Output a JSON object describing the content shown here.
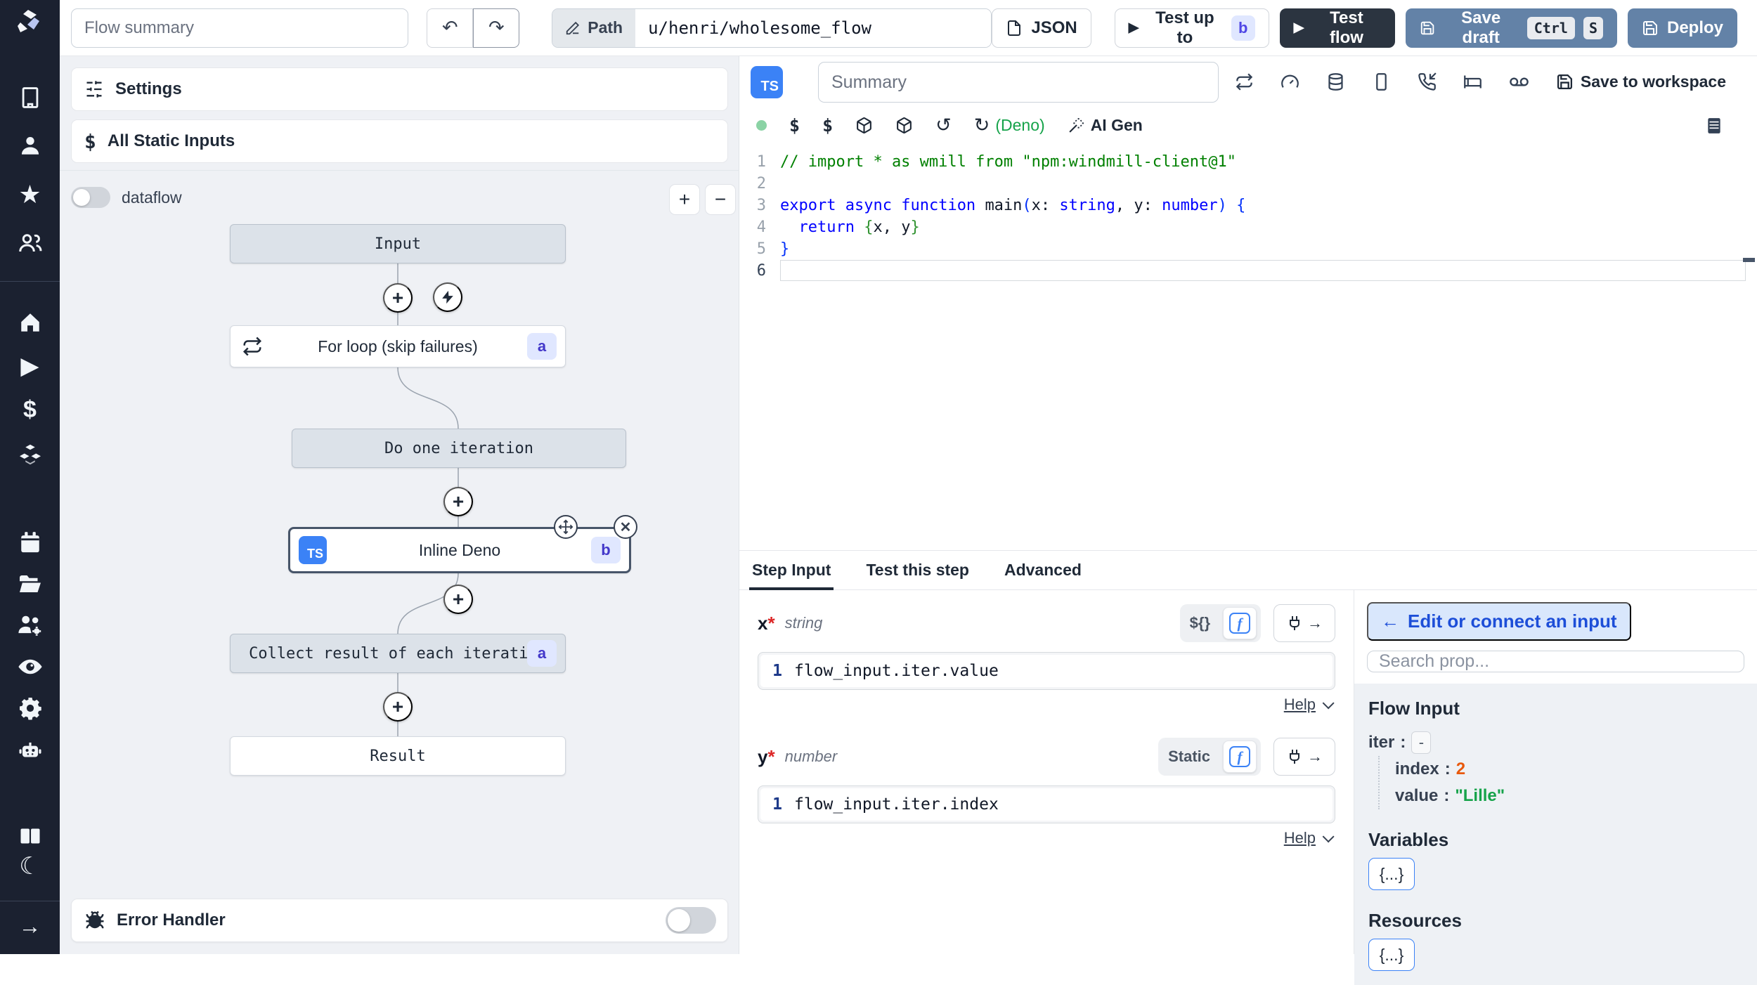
{
  "topbar": {
    "summary_placeholder": "Flow summary",
    "path_label": "Path",
    "path_value": "u/henri/wholesome_flow",
    "json_label": "JSON",
    "test_up_to_label": "Test up to",
    "test_up_to_badge": "b",
    "test_flow_label": "Test flow",
    "save_draft_label": "Save draft",
    "kbd_ctrl": "Ctrl",
    "kbd_s": "S",
    "deploy_label": "Deploy"
  },
  "flow_panel": {
    "settings_label": "Settings",
    "static_inputs_label": "All Static Inputs",
    "dataflow_label": "dataflow",
    "zoom_in": "+",
    "zoom_out": "−",
    "error_handler_label": "Error Handler",
    "nodes": {
      "input": {
        "label": "Input"
      },
      "forloop": {
        "label": "For loop (skip failures)",
        "badge": "a"
      },
      "iteration": {
        "label": "Do one iteration"
      },
      "inline": {
        "label": "Inline Deno",
        "badge": "b",
        "lang": "TS"
      },
      "collect": {
        "label": "Collect result of each iteration",
        "badge": "a"
      },
      "result": {
        "label": "Result"
      }
    }
  },
  "editor": {
    "lang_badge": "TS",
    "summary_placeholder": "Summary",
    "dollar1": "$",
    "dollar2": "$",
    "deno_label": "(Deno)",
    "ai_gen_label": "AI Gen",
    "save_workspace_label": "Save to workspace",
    "code_lines": [
      {
        "num": "1",
        "active": false,
        "tokens": [
          {
            "c": "com",
            "t": "// import * as wmill from \"npm:windmill-client@1\""
          }
        ]
      },
      {
        "num": "2",
        "active": false,
        "tokens": []
      },
      {
        "num": "3",
        "active": false,
        "tokens": [
          {
            "c": "kw",
            "t": "export"
          },
          {
            "c": "txt",
            "t": " "
          },
          {
            "c": "kw",
            "t": "async"
          },
          {
            "c": "txt",
            "t": " "
          },
          {
            "c": "kw",
            "t": "function"
          },
          {
            "c": "txt",
            "t": " "
          },
          {
            "c": "fn",
            "t": "main"
          },
          {
            "c": "b1",
            "t": "("
          },
          {
            "c": "txt",
            "t": "x"
          },
          {
            "c": "txt",
            "t": ": "
          },
          {
            "c": "typ",
            "t": "string"
          },
          {
            "c": "txt",
            "t": ", "
          },
          {
            "c": "txt",
            "t": "y"
          },
          {
            "c": "txt",
            "t": ": "
          },
          {
            "c": "typ",
            "t": "number"
          },
          {
            "c": "b1",
            "t": ") "
          },
          {
            "c": "b1",
            "t": "{"
          }
        ]
      },
      {
        "num": "4",
        "active": false,
        "tokens": [
          {
            "c": "txt",
            "t": "  "
          },
          {
            "c": "kw",
            "t": "return"
          },
          {
            "c": "txt",
            "t": " "
          },
          {
            "c": "b2",
            "t": "{"
          },
          {
            "c": "txt",
            "t": "x, y"
          },
          {
            "c": "b2",
            "t": "}"
          }
        ]
      },
      {
        "num": "5",
        "active": false,
        "tokens": [
          {
            "c": "b1",
            "t": "}"
          }
        ]
      },
      {
        "num": "6",
        "active": true,
        "tokens": []
      }
    ]
  },
  "panel": {
    "tabs": [
      {
        "label": "Step Input"
      },
      {
        "label": "Test this step"
      },
      {
        "label": "Advanced"
      }
    ],
    "fields": [
      {
        "name": "x",
        "required": "*",
        "type": "string",
        "mode": "${}",
        "line_no": "1",
        "expr": "flow_input.iter.value",
        "help": "Help"
      },
      {
        "name": "y",
        "required": "*",
        "type": "number",
        "mode": "Static",
        "line_no": "1",
        "expr": "flow_input.iter.index",
        "help": "Help"
      }
    ]
  },
  "connect": {
    "back_arrow": "←",
    "back_label": "Edit or connect an input",
    "search_placeholder": "Search prop...",
    "flow_input_title": "Flow Input",
    "tree": {
      "iter_label": "iter",
      "colon": ":",
      "iter_toggle": "-",
      "index_label": "index",
      "index_value": "2",
      "value_label": "value",
      "value_value": "\"Lille\""
    },
    "variables_title": "Variables",
    "variables_button": "{...}",
    "resources_title": "Resources",
    "resources_button": "{...}"
  },
  "colors": {
    "accent_blue": "#3b82f6",
    "button_blue": "#6382a7",
    "dark_navy": "#2b3440",
    "sidebar_bg": "#1b2130",
    "badge_bg": "#e0e7ff",
    "badge_text": "#4338ca",
    "green_value": "#16a34a",
    "orange_value": "#e8590c"
  }
}
